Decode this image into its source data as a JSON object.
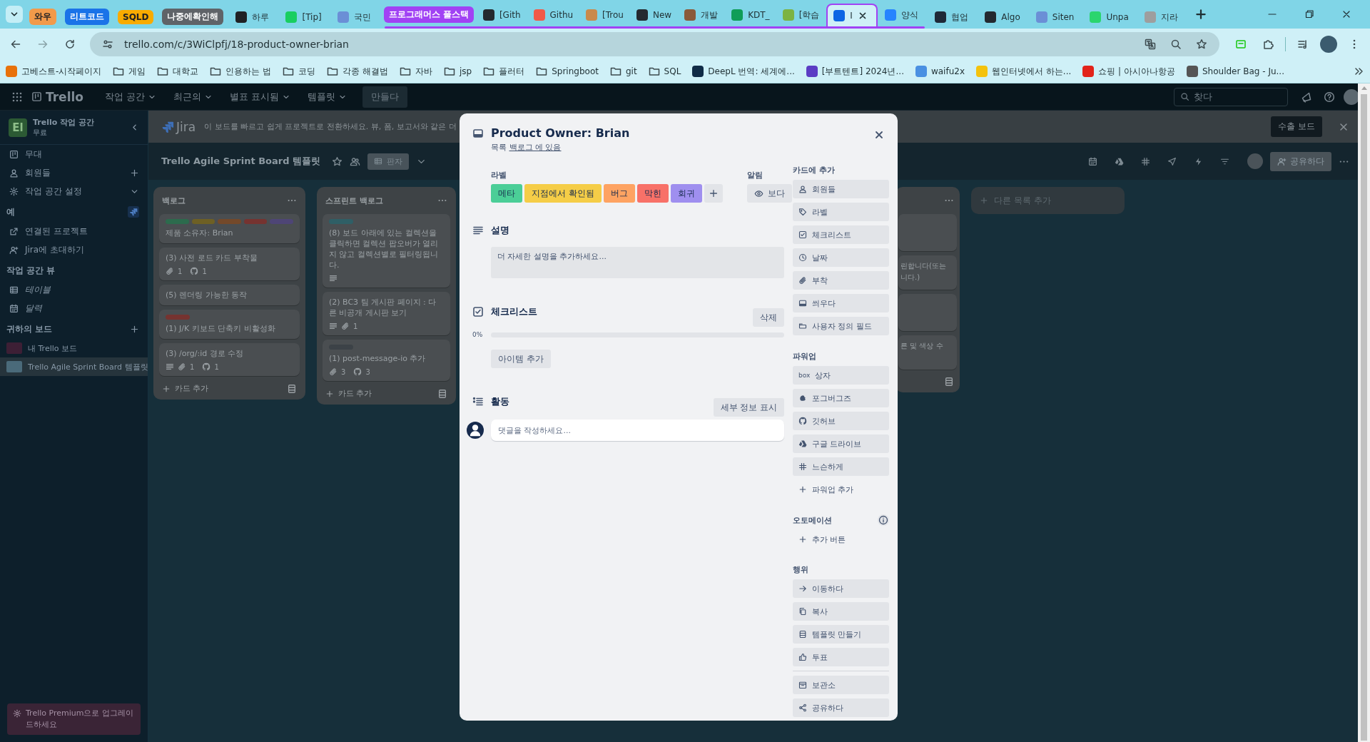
{
  "browser": {
    "tabs": [
      {
        "kind": "group",
        "label": "와우",
        "color": "#f29a4a",
        "expanded": false
      },
      {
        "kind": "group",
        "label": "리트코드",
        "color": "#1a73e8",
        "expanded": false
      },
      {
        "kind": "group",
        "label": "SQLD",
        "color": "#f9ab00",
        "expanded": false
      },
      {
        "kind": "group",
        "label": "나중에확인해",
        "color": "#5f6368",
        "expanded": false
      },
      {
        "kind": "tab",
        "label": "하루",
        "color": "#202124",
        "selected": false
      },
      {
        "kind": "tab",
        "label": "[Tip]",
        "color": "#19ce60",
        "selected": false
      },
      {
        "kind": "tab",
        "label": "국민",
        "color": "#6b8fd6",
        "selected": false
      },
      {
        "kind": "group",
        "label": "프로그래머스 풀스택",
        "color": "#a142f4",
        "expanded": true,
        "tabs": [
          {
            "label": "[Gith",
            "color": "#24292f",
            "selected": false
          },
          {
            "label": "Githu",
            "color": "#f05a48",
            "selected": false
          },
          {
            "label": "[Trou",
            "color": "#c98a4b",
            "selected": false
          },
          {
            "label": "New",
            "color": "#24292f",
            "selected": false
          },
          {
            "label": "개발",
            "color": "#8a5a3a",
            "selected": false
          },
          {
            "label": "KDT_",
            "color": "#0f9d58",
            "selected": false
          },
          {
            "label": "[학습",
            "color": "#7cb342",
            "selected": false
          },
          {
            "label": "I",
            "color": "#0c66e4",
            "selected": true
          },
          {
            "label": "양식",
            "color": "#2684ff",
            "selected": false
          }
        ]
      },
      {
        "kind": "tab",
        "label": "협업",
        "color": "#1f2937",
        "selected": false
      },
      {
        "kind": "tab",
        "label": "Algo",
        "color": "#24292f",
        "selected": false
      },
      {
        "kind": "tab",
        "label": "Siten",
        "color": "#6b8fd6",
        "selected": false
      },
      {
        "kind": "tab",
        "label": "Unpa",
        "color": "#2bd56e",
        "selected": false
      },
      {
        "kind": "tab",
        "label": "지라",
        "color": "#9e9e9e",
        "selected": false
      }
    ],
    "url": "trello.com/c/3WiClpfj/18-product-owner-brian",
    "bookmarks": [
      {
        "kind": "site",
        "label": "고베스트-시작페이지",
        "color": "#e8710a"
      },
      {
        "kind": "folder",
        "label": "게임"
      },
      {
        "kind": "folder",
        "label": "대학교"
      },
      {
        "kind": "folder",
        "label": "인용하는 법"
      },
      {
        "kind": "folder",
        "label": "코딩"
      },
      {
        "kind": "folder",
        "label": "각종 해결법"
      },
      {
        "kind": "folder",
        "label": "자바"
      },
      {
        "kind": "folder",
        "label": "jsp"
      },
      {
        "kind": "folder",
        "label": "플러터"
      },
      {
        "kind": "folder",
        "label": "Springboot"
      },
      {
        "kind": "folder",
        "label": "git"
      },
      {
        "kind": "folder",
        "label": "SQL"
      },
      {
        "kind": "site",
        "label": "DeepL 번역: 세계에...",
        "color": "#0f2b46"
      },
      {
        "kind": "site",
        "label": "[부트텐트] 2024년...",
        "color": "#5b3cc4"
      },
      {
        "kind": "site",
        "label": "waifu2x",
        "color": "#4a90e2"
      },
      {
        "kind": "site",
        "label": "웹인터넷에서 하는...",
        "color": "#f4c20d"
      },
      {
        "kind": "site",
        "label": "쇼핑 | 아시아나항공",
        "color": "#e2231a"
      },
      {
        "kind": "site",
        "label": "Shoulder Bag - Ju...",
        "color": "#555555"
      }
    ]
  },
  "trello": {
    "logo": "Trello",
    "menus": [
      "작업 공간",
      "최근의",
      "별표 표시됨",
      "템플릿"
    ],
    "create": "만들다",
    "search_placeholder": "찾다"
  },
  "sidebar": {
    "workspace": {
      "initial": "El",
      "name": "Trello 작업 공간",
      "plan": "무료"
    },
    "items": [
      {
        "label": "무대",
        "kind": "link"
      },
      {
        "label": "회원들",
        "kind": "add"
      },
      {
        "label": "작업 공간 설정",
        "kind": "expand"
      }
    ],
    "jira_heading": "예",
    "jira_items": [
      {
        "label": "연결된 프로젝트"
      },
      {
        "label": "Jira에 초대하기"
      }
    ],
    "views_heading": "작업 공간 뷰",
    "views": [
      {
        "label": "테이블"
      },
      {
        "label": "달력"
      }
    ],
    "boards_heading": "귀하의 보드",
    "boards": [
      {
        "label": "내 Trello 보드",
        "color": "#3d1f35",
        "selected": false
      },
      {
        "label": "Trello Agile Sprint Board 템플릿",
        "color": "#4a6a7a",
        "selected": true
      }
    ],
    "upgrade": "Trello Premium으로 업그레이드하세요"
  },
  "jira_banner": {
    "product": "Jira",
    "message": "이 보드를 빠르고 쉽게 프로젝트로 전환하세요. 뷰, 폼, 보고서와 같은 더",
    "button": "수출 보드"
  },
  "board": {
    "title": "Trello Agile Sprint Board 템플릿",
    "view": "판자",
    "share": "공유하다",
    "add_list": "다른 목록 추가",
    "lists": [
      {
        "kind": "full",
        "title": "백로그",
        "add_card": "카드 추가",
        "cards": [
          {
            "labels": [
              {
                "color": "#2c6b4d"
              },
              {
                "color": "#6e6024"
              },
              {
                "color": "#74492a"
              },
              {
                "color": "#763330"
              },
              {
                "color": "#4e4576"
              }
            ],
            "title": "제품 소유자: Brian"
          },
          {
            "title": "(3) 사전 로드 카드 부착물",
            "badges": [
              {
                "kind": "attachment",
                "count": "1"
              },
              {
                "kind": "github",
                "count": "1"
              }
            ]
          },
          {
            "title": "(5) 렌더링 가능한 동작"
          },
          {
            "labels": [
              {
                "color": "#763330"
              }
            ],
            "title": "(1) J/K 키보드 단축키 비활성화"
          },
          {
            "title": "(3) /org/:id 경로 수정",
            "badges": [
              {
                "kind": "description"
              },
              {
                "kind": "attachment",
                "count": "1"
              },
              {
                "kind": "github",
                "count": "1"
              }
            ]
          }
        ]
      },
      {
        "kind": "full",
        "title": "스프린트 백로그",
        "add_card": "카드 추가",
        "cards": [
          {
            "labels": [
              {
                "color": "#2f5f66"
              }
            ],
            "title": "(8) 보드 아래에 있는 컬렉션을 클릭하면 컬렉션 팝오버가 열리지 않고 컬렉션별로 필터링됩니다.",
            "badges": [
              {
                "kind": "description"
              }
            ]
          },
          {
            "title": "(2) BC3 팀 게시판 페이지 : 다른 비공개 게시판 보기",
            "badges": [
              {
                "kind": "description"
              },
              {
                "kind": "attachment",
                "count": "1"
              }
            ]
          },
          {
            "labels": [
              {
                "color": "#3c4247"
              }
            ],
            "title": "(1) post-message-io 추가",
            "badges": [
              {
                "kind": "attachment",
                "count": "3"
              },
              {
                "kind": "github",
                "count": "3"
              }
            ]
          }
        ]
      },
      {
        "kind": "clipped",
        "cards": [
          {
            "kind": "blank"
          },
          {
            "kind": "text",
            "lines": [
              "린합니다(또는",
              "니다.)"
            ]
          },
          {
            "kind": "blank"
          },
          {
            "kind": "text",
            "lines": [
              "른 및 색상 수"
            ]
          }
        ]
      }
    ]
  },
  "card_modal": {
    "title": "Product Owner: Brian",
    "list_prefix": "목록",
    "list_link": "백로그 에 있음",
    "labels_heading": "라벨",
    "labels": [
      {
        "text": "메타",
        "color": "#4bce97"
      },
      {
        "text": "지점에서 확인됨",
        "color": "#f5cd47"
      },
      {
        "text": "버그",
        "color": "#fea362"
      },
      {
        "text": "막힌",
        "color": "#f87168"
      },
      {
        "text": "회귀",
        "color": "#9f8fef"
      }
    ],
    "notify_heading": "알림",
    "watch": "보다",
    "description_heading": "설명",
    "description_placeholder": "더 자세한 설명을 추가하세요...",
    "checklist_heading": "체크리스트",
    "checklist_delete": "삭제",
    "checklist_percent": "0%",
    "checklist": {
      "level": 0
    },
    "checklist_add": "아이템 추가",
    "activity_heading": "활동",
    "activity_details": "세부 정보 표시",
    "comment_placeholder": "댓글을 작성하세요...",
    "side_sections": [
      {
        "kind": "buttons",
        "heading": "카드에 추가",
        "items": [
          {
            "label": "회원들"
          },
          {
            "label": "라벨"
          },
          {
            "label": "체크리스트"
          },
          {
            "label": "날짜"
          },
          {
            "label": "부착"
          },
          {
            "label": "씌우다"
          },
          {
            "label": "사용자 정의 필드"
          }
        ]
      },
      {
        "kind": "buttons",
        "heading": "파워업",
        "items": [
          {
            "label": "상자",
            "icon_text": "box"
          },
          {
            "label": "포그버그즈"
          },
          {
            "label": "깃허브"
          },
          {
            "label": "구글 드라이브"
          },
          {
            "label": "느슨하게"
          }
        ],
        "add": "파워업 추가"
      },
      {
        "kind": "automation",
        "heading": "오토메이션",
        "add": "추가 버튼"
      },
      {
        "kind": "buttons",
        "heading": "행위",
        "items": [
          {
            "label": "이동하다"
          },
          {
            "label": "복사"
          },
          {
            "label": "템플릿 만들기"
          },
          {
            "label": "투표"
          }
        ],
        "after_divider": [
          {
            "label": "보관소"
          },
          {
            "label": "공유하다"
          }
        ]
      }
    ]
  }
}
